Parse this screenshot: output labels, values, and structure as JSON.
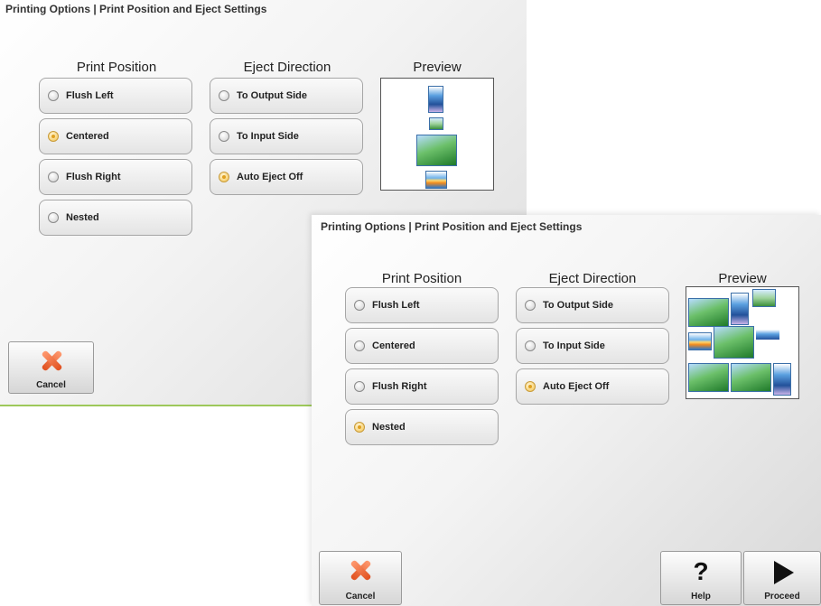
{
  "screens": [
    {
      "title": "Printing Options | Print Position and Eject Settings",
      "print_position": {
        "heading": "Print Position",
        "options": [
          "Flush Left",
          "Centered",
          "Flush Right",
          "Nested"
        ],
        "selected": "Centered"
      },
      "eject_direction": {
        "heading": "Eject Direction",
        "options": [
          "To Output Side",
          "To Input Side",
          "Auto Eject Off"
        ],
        "selected": "Auto Eject Off"
      },
      "preview": {
        "heading": "Preview"
      },
      "buttons": {
        "cancel": "Cancel"
      }
    },
    {
      "title": "Printing Options | Print Position and Eject Settings",
      "print_position": {
        "heading": "Print Position",
        "options": [
          "Flush Left",
          "Centered",
          "Flush Right",
          "Nested"
        ],
        "selected": "Nested"
      },
      "eject_direction": {
        "heading": "Eject Direction",
        "options": [
          "To Output Side",
          "To Input Side",
          "Auto Eject Off"
        ],
        "selected": "Auto Eject Off"
      },
      "preview": {
        "heading": "Preview"
      },
      "buttons": {
        "cancel": "Cancel",
        "help": "Help",
        "proceed": "Proceed"
      }
    }
  ],
  "colors": {
    "accent_green": "#9dc85a",
    "radio_selected": "#f3c24a",
    "cancel_icon": "#e0501f"
  }
}
